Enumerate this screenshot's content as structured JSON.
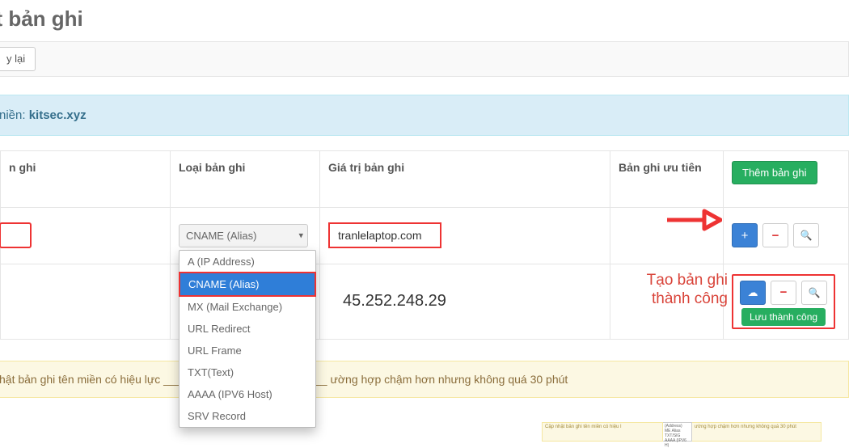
{
  "page": {
    "title": "ật bản ghi"
  },
  "toolbar": {
    "back_label": "y lại"
  },
  "domain_panel": {
    "prefix": "niền: ",
    "domain": "kitsec.xyz"
  },
  "table": {
    "headers": {
      "host": "n ghi",
      "type": "Loại bản ghi",
      "value": "Giá trị bản ghi",
      "priority": "Bản ghi ưu tiên",
      "add_button": "Thêm bản ghi"
    },
    "select_visible": "CNAME (Alias)",
    "options": [
      "A (IP Address)",
      "CNAME (Alias)",
      "MX (Mail Exchange)",
      "URL Redirect",
      "URL Frame",
      "TXT(Text)",
      "AAAA (IPV6 Host)",
      "SRV Record"
    ],
    "row1": {
      "host_value": "",
      "value_input": "tranlelaptop.com"
    },
    "row2": {
      "value_text": "45.252.248.29",
      "save_badge": "Lưu thành công"
    }
  },
  "annotations": {
    "success_text": "Tạo bản ghi\nthành công"
  },
  "icons": {
    "plus": "+",
    "minus": "−",
    "search": "🔍",
    "cloud": "☁"
  },
  "note": {
    "text": "hật bản ghi tên miền có hiệu lực ____ ______ ______ ____ ____ ường hợp chậm hơn nhưng không quá 30 phút"
  },
  "footer": {
    "panel1": "Cập nhật bản ghi tên miền có hiệu l",
    "panel2": "ường hợp chậm hơn nhưng không quá 30 phút",
    "list": [
      "(Address)",
      "ME Alias",
      "TXT/SIG",
      "AAAA (IPV6 H)"
    ]
  }
}
